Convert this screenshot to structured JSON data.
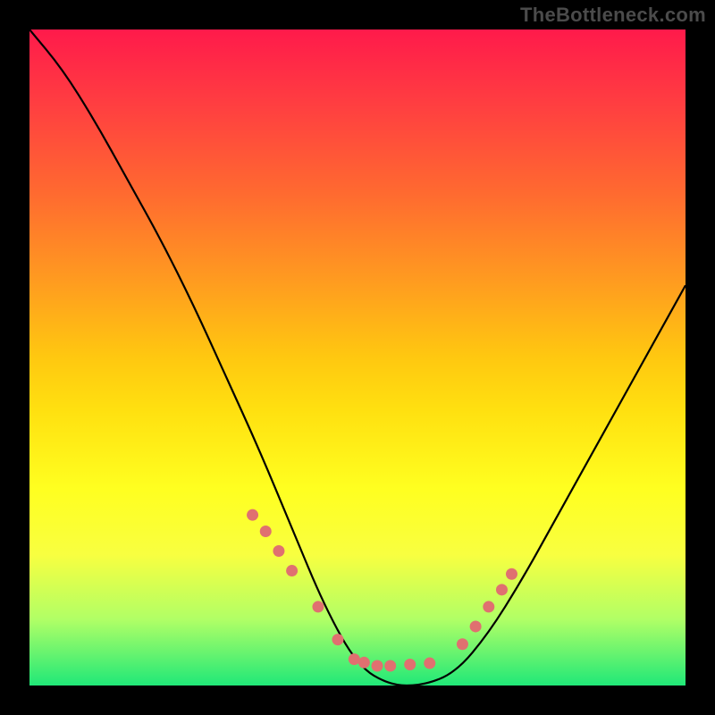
{
  "watermark": "TheBottleneck.com",
  "chart_data": {
    "type": "line",
    "title": "",
    "xlabel": "",
    "ylabel": "",
    "xlim": [
      0,
      100
    ],
    "ylim": [
      0,
      100
    ],
    "series": [
      {
        "name": "curve",
        "x": [
          0,
          5,
          10,
          15,
          20,
          25,
          30,
          35,
          40,
          45,
          50,
          55,
          60,
          65,
          70,
          75,
          80,
          85,
          90,
          95,
          100
        ],
        "y": [
          100,
          94,
          86,
          77,
          68,
          58,
          47,
          36,
          24,
          12,
          3,
          0,
          0,
          2,
          8,
          16,
          25,
          34,
          43,
          52,
          61
        ]
      }
    ],
    "highlight_points": {
      "x": [
        34,
        36,
        38,
        40,
        44,
        47,
        49.5,
        51,
        53,
        55,
        58,
        61,
        66,
        68,
        70,
        72,
        73.5
      ],
      "y": [
        26,
        23.5,
        20.5,
        17.5,
        12,
        7,
        4,
        3.5,
        3,
        3,
        3.2,
        3.4,
        6.3,
        9,
        12,
        14.6,
        17
      ]
    },
    "gradient_stops": [
      {
        "pos": 0.0,
        "color": "#ff1a4b"
      },
      {
        "pos": 0.12,
        "color": "#ff4040"
      },
      {
        "pos": 0.25,
        "color": "#ff6a30"
      },
      {
        "pos": 0.38,
        "color": "#ff9a20"
      },
      {
        "pos": 0.5,
        "color": "#ffc810"
      },
      {
        "pos": 0.58,
        "color": "#ffe010"
      },
      {
        "pos": 0.7,
        "color": "#ffff20"
      },
      {
        "pos": 0.8,
        "color": "#f8ff40"
      },
      {
        "pos": 0.9,
        "color": "#b0ff66"
      },
      {
        "pos": 1.0,
        "color": "#20e878"
      }
    ],
    "highlight_color": "#e07070"
  }
}
